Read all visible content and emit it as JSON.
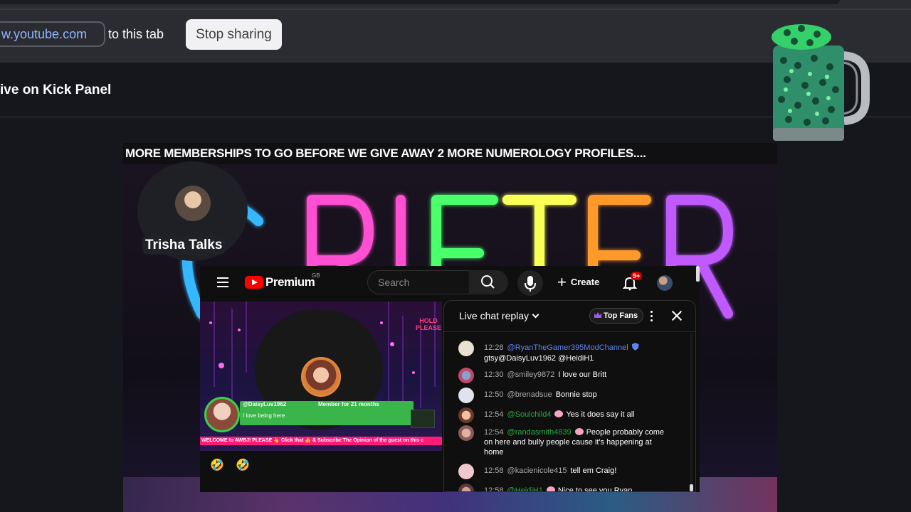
{
  "share_bar": {
    "url": "w.youtube.com",
    "suffix": "to this tab",
    "stop_label": "Stop sharing"
  },
  "page": {
    "panel_title": "ive on Kick Panel"
  },
  "video": {
    "banner": "MORE MEMBERSHIPS TO GO BEFORE WE GIVE AWAY 2 MORE NUMEROLOGY PROFILES....",
    "host_name": "Trisha Talks",
    "neon_text": "GRIFTER"
  },
  "youtube": {
    "brand": "Premium",
    "region": "GB",
    "search_placeholder": "Search",
    "create_label": "Create",
    "notif_badge": "9+",
    "player": {
      "hold_text": "HOLD PLEASE",
      "member_handle": "@DaisyLuv1962",
      "member_months": "Member for 21 months",
      "member_message": "I love being here",
      "ticker": "WELCOME to AWBJ! PLEASE 👆 Click that 👍 & Subscribe     The Opinion of the guest on this c"
    },
    "reaction_row": "🤣 🤣"
  },
  "chat": {
    "title": "Live chat replay",
    "top_fans": "Top Fans",
    "messages": [
      {
        "time": "12:28",
        "author": "@RyanTheGamer395ModChannel",
        "text": "gtsy@DaisyLuv1962 @HeidiH1",
        "color": "#5e84f1"
      },
      {
        "time": "12:30",
        "author": "@smiley9872",
        "text": "I love our Britt",
        "color": "#aaaaaa"
      },
      {
        "time": "12:50",
        "author": "@brenadsue",
        "text": "Bonnie stop",
        "color": "#aaaaaa"
      },
      {
        "time": "12:54",
        "author": "@Soulchild4",
        "text": "Yes it does say it all",
        "color": "#2ba640"
      },
      {
        "time": "12:54",
        "author": "@randasmith4839",
        "text": "People probably come",
        "text_cont": "on here and bully people cause it's happening at home",
        "color": "#2ba640"
      },
      {
        "time": "12:58",
        "author": "@kacienicole415",
        "text": "tell em Craig!",
        "color": "#aaaaaa"
      },
      {
        "time": "12:58",
        "author": "@HeidiH1",
        "text": "Nice to see you Ryan",
        "color": "#2ba640"
      }
    ]
  }
}
